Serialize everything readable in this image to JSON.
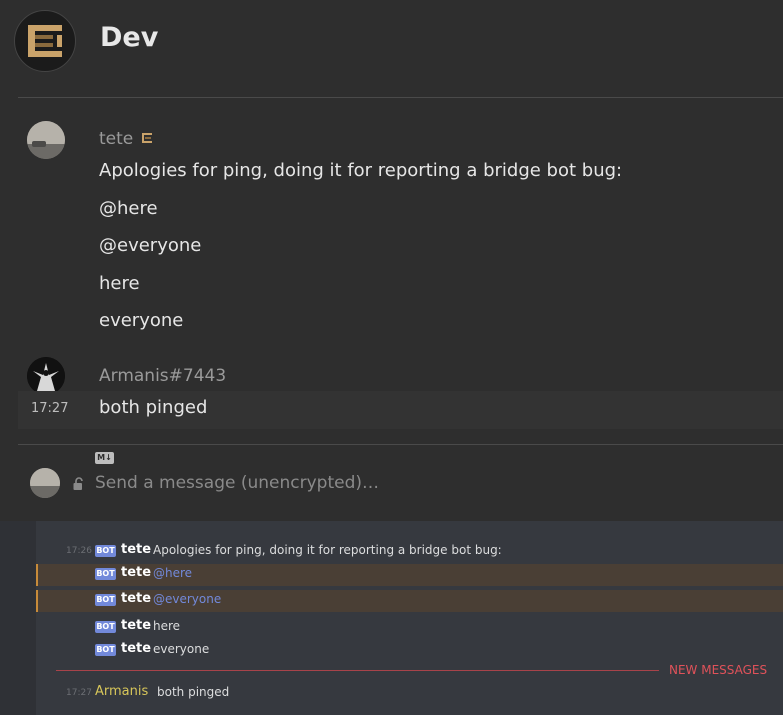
{
  "room": {
    "name": "Dev",
    "avatar_icon": "room-logo-icon"
  },
  "timeline": {
    "message1": {
      "sender": "tete",
      "lines": [
        "Apologies for ping, doing it for reporting a bridge bot bug:",
        "@here",
        "@everyone",
        "here",
        "everyone"
      ]
    },
    "message2": {
      "sender": "Armanis#7443",
      "timestamp": "17:27",
      "text": "both pinged"
    }
  },
  "composer": {
    "format_badge": "M↓",
    "placeholder": "Send a message (unencrypted)…"
  },
  "discord": {
    "bot_tag": "BOT",
    "rows": [
      {
        "timestamp": "17:26",
        "name": "tete",
        "text": "Apologies for ping, doing it for reporting a bridge bot bug:"
      },
      {
        "timestamp": "",
        "name": "tete",
        "text": "@here"
      },
      {
        "timestamp": "",
        "name": "tete",
        "text": "@everyone"
      },
      {
        "timestamp": "",
        "name": "tete",
        "text": "here"
      },
      {
        "timestamp": "",
        "name": "tete",
        "text": "everyone"
      }
    ],
    "new_messages_label": "NEW MESSAGES",
    "last": {
      "timestamp": "17:27",
      "name": "Armanis",
      "text": "both pinged"
    }
  },
  "colors": {
    "matrix_bg": "#2e2e2e",
    "discord_bg": "#36393f",
    "bot_tag": "#7289da",
    "mention_highlight": "#4a3f35",
    "new_messages": "#e0525a",
    "armanis_name": "#d7c65a"
  }
}
